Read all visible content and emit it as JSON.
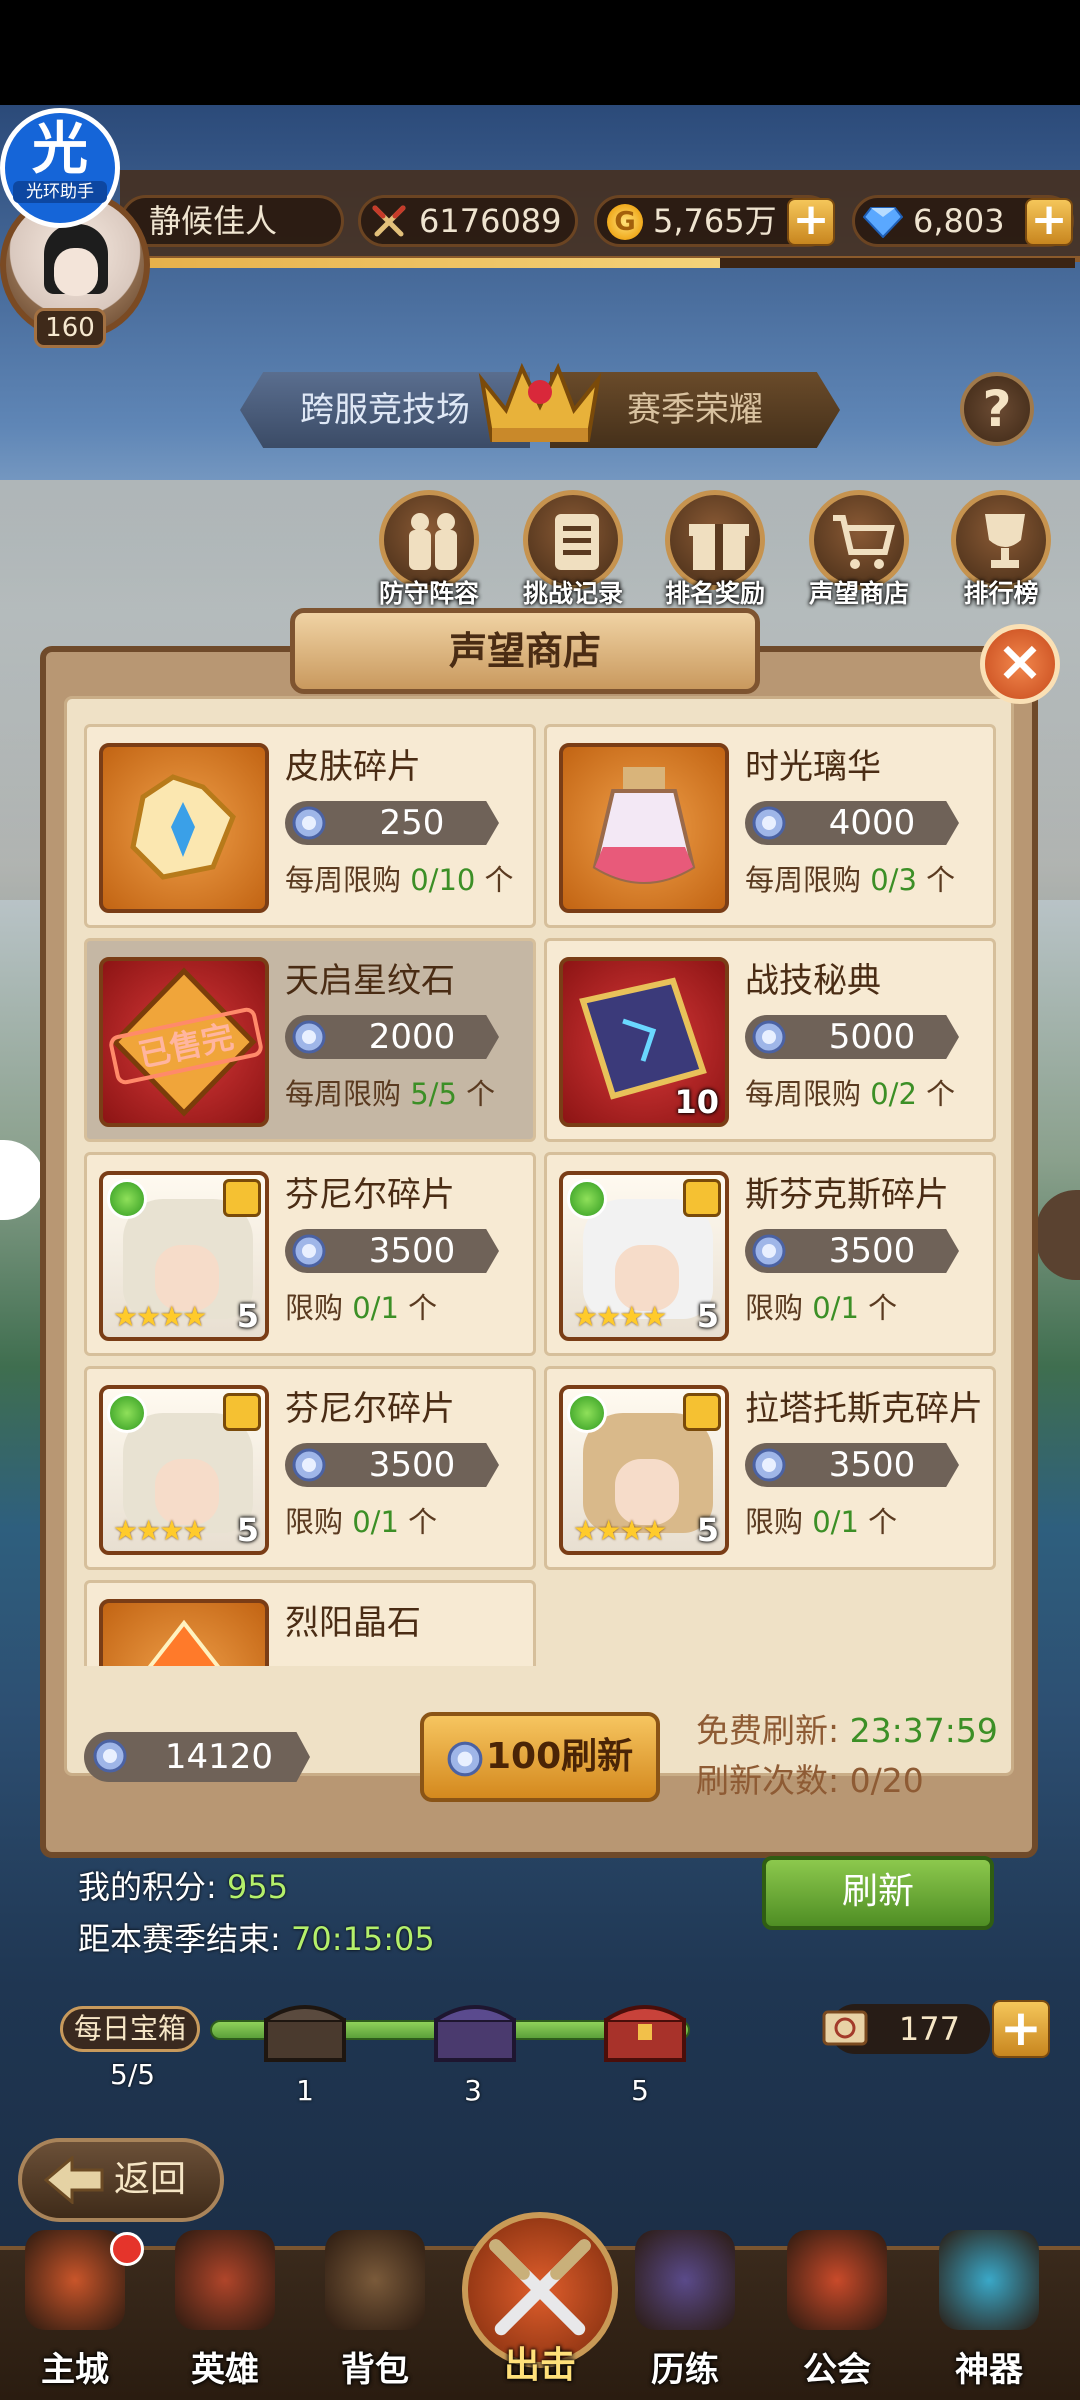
{
  "header": {
    "helper_badge_char": "光",
    "helper_badge_label": "光环助手",
    "player_name": "静候佳人",
    "level": "160",
    "power": "6176089",
    "gold": "5,765万",
    "gems": "6,803",
    "exp_progress": 0.62
  },
  "tabs": {
    "left": "跨服竞技场",
    "right": "赛季荣耀",
    "help": "?"
  },
  "menu": [
    {
      "label": "防守阵容",
      "icon": "defense-team-icon"
    },
    {
      "label": "挑战记录",
      "icon": "record-icon"
    },
    {
      "label": "排名奖励",
      "icon": "gift-icon"
    },
    {
      "label": "声望商店",
      "icon": "cart-icon"
    },
    {
      "label": "排行榜",
      "icon": "trophy-icon"
    }
  ],
  "shop": {
    "title": "声望商店",
    "close": "×",
    "items": [
      {
        "name": "皮肤碎片",
        "price": "250",
        "limit_prefix": "每周限购 ",
        "limit_value": "0/10",
        "limit_suffix": " 个",
        "icon": "skin-fragment-icon"
      },
      {
        "name": "时光璃华",
        "price": "4000",
        "limit_prefix": "每周限购 ",
        "limit_value": "0/3",
        "limit_suffix": " 个",
        "icon": "potion-icon"
      },
      {
        "name": "天启星纹石",
        "price": "2000",
        "limit_prefix": "每周限购 ",
        "limit_value": "5/5",
        "limit_suffix": " 个",
        "icon": "star-stone-icon",
        "sold_stamp": "已售完"
      },
      {
        "name": "战技秘典",
        "price": "5000",
        "limit_prefix": "每周限购 ",
        "limit_value": "0/2",
        "limit_suffix": " 个",
        "icon": "book-icon",
        "count": "10"
      },
      {
        "name": "芬尼尔碎片",
        "price": "3500",
        "limit_prefix": "限购 ",
        "limit_value": "0/1",
        "limit_suffix": " 个",
        "icon": "hero-portrait-icon",
        "count": "5",
        "stars": "★★★★"
      },
      {
        "name": "斯芬克斯碎片",
        "price": "3500",
        "limit_prefix": "限购 ",
        "limit_value": "0/1",
        "limit_suffix": " 个",
        "icon": "hero-portrait-icon",
        "count": "5",
        "stars": "★★★★"
      },
      {
        "name": "芬尼尔碎片",
        "price": "3500",
        "limit_prefix": "限购 ",
        "limit_value": "0/1",
        "limit_suffix": " 个",
        "icon": "hero-portrait-icon",
        "count": "5",
        "stars": "★★★★"
      },
      {
        "name": "拉塔托斯克碎片",
        "price": "3500",
        "limit_prefix": "限购 ",
        "limit_value": "0/1",
        "limit_suffix": " 个",
        "icon": "hero-portrait-icon",
        "count": "5",
        "stars": "★★★★"
      },
      {
        "name": "烈阳晶石",
        "icon": "crystal-icon"
      }
    ],
    "points": "14120",
    "refresh_cost": "100刷新",
    "free_refresh_label": "免费刷新: ",
    "free_refresh_time": "23:37:59",
    "refresh_count_label": "刷新次数: 0/20"
  },
  "status": {
    "my_points_label": "我的积分: ",
    "my_points_value": "955",
    "season_end_label": "距本赛季结束: ",
    "season_end_value": "70:15:05",
    "refresh_button": "刷新"
  },
  "daily_chest": {
    "label": "每日宝箱",
    "count": "5/5",
    "milestones": [
      "1",
      "3",
      "5"
    ],
    "tickets": "177"
  },
  "back_label": "返回",
  "nav": [
    {
      "label": "主城",
      "icon": "castle-icon"
    },
    {
      "label": "英雄",
      "icon": "hero-icon"
    },
    {
      "label": "背包",
      "icon": "backpack-icon"
    },
    {
      "label": "出击",
      "icon": "crossed-swords-icon"
    },
    {
      "label": "历练",
      "icon": "training-icon"
    },
    {
      "label": "公会",
      "icon": "guild-icon"
    },
    {
      "label": "神器",
      "icon": "artifact-icon"
    }
  ],
  "colors": {
    "accent_green": "#3c8f26",
    "panel_bg": "#efe1c6",
    "frame_brown": "#6f4a2a"
  }
}
